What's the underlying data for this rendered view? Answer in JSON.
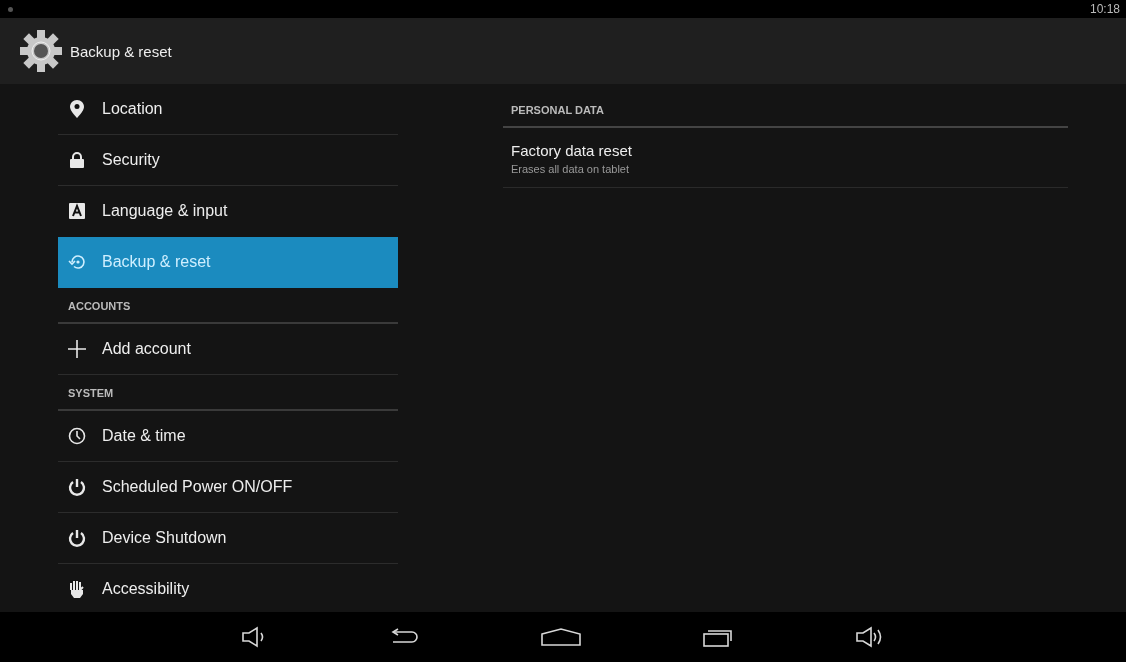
{
  "status_bar": {
    "time": "10:18"
  },
  "action_bar": {
    "title": "Backup & reset"
  },
  "sidebar": {
    "items": [
      {
        "kind": "item",
        "label": "Location",
        "selected": false
      },
      {
        "kind": "item",
        "label": "Security",
        "selected": false
      },
      {
        "kind": "item",
        "label": "Language & input",
        "selected": false
      },
      {
        "kind": "item",
        "label": "Backup & reset",
        "selected": true
      },
      {
        "kind": "header",
        "label": "ACCOUNTS"
      },
      {
        "kind": "item",
        "label": "Add account",
        "selected": false
      },
      {
        "kind": "header",
        "label": "SYSTEM"
      },
      {
        "kind": "item",
        "label": "Date & time",
        "selected": false
      },
      {
        "kind": "item",
        "label": "Scheduled Power ON/OFF",
        "selected": false
      },
      {
        "kind": "item",
        "label": "Device Shutdown",
        "selected": false
      },
      {
        "kind": "item",
        "label": "Accessibility",
        "selected": false
      }
    ]
  },
  "detail": {
    "sections": [
      {
        "header": "PERSONAL DATA",
        "items": [
          {
            "title": "Factory data reset",
            "summary": "Erases all data on tablet"
          }
        ]
      }
    ]
  },
  "nav_bar": {
    "buttons": [
      {
        "kind": "volume_down"
      },
      {
        "kind": "back"
      },
      {
        "kind": "home"
      },
      {
        "kind": "recents"
      },
      {
        "kind": "volume_up"
      }
    ]
  }
}
